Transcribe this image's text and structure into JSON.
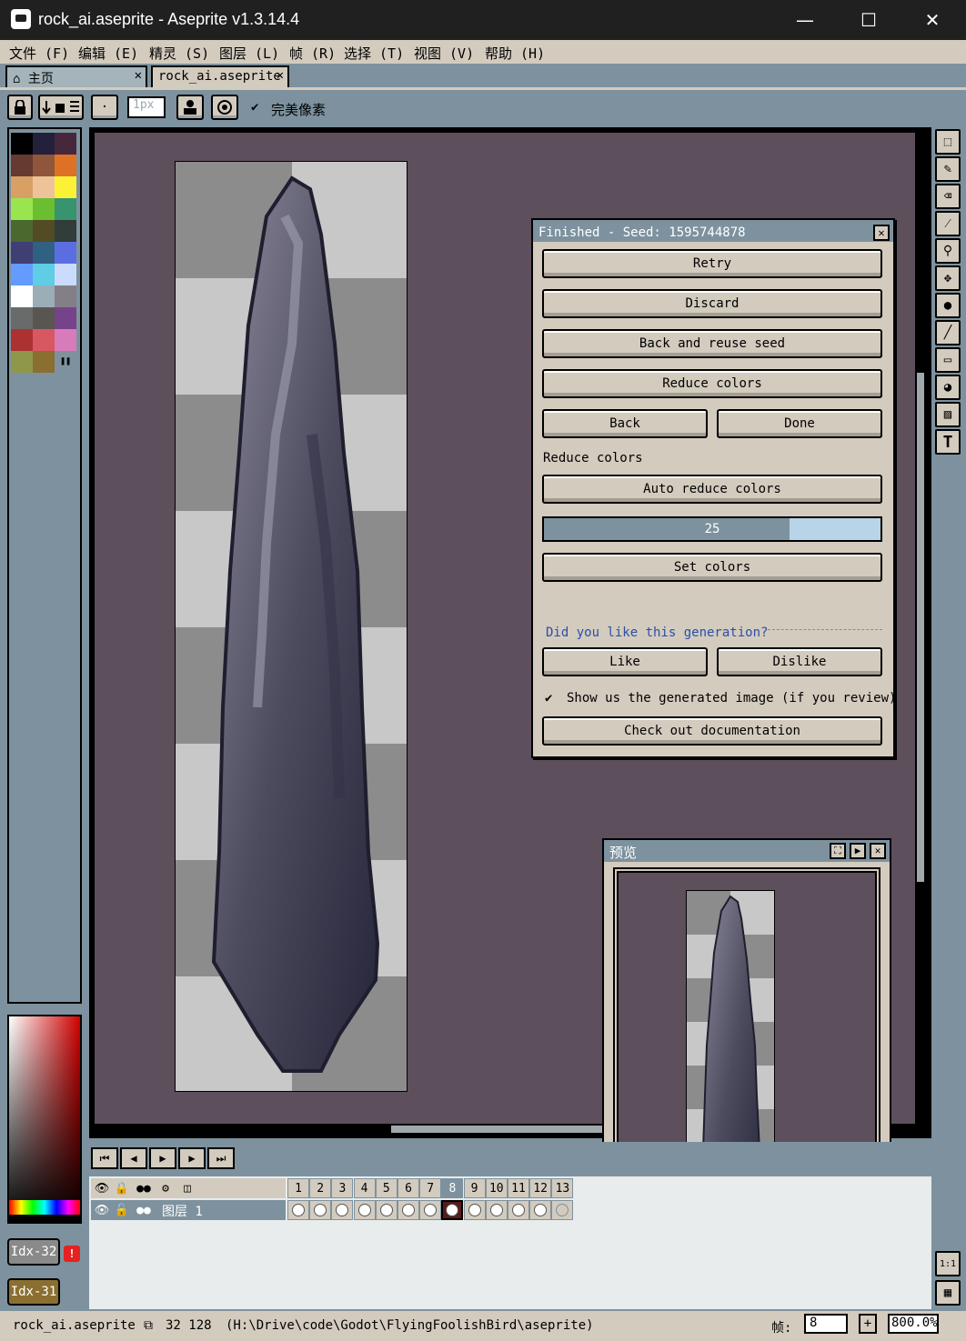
{
  "window": {
    "title": "rock_ai.aseprite - Aseprite v1.3.14.4",
    "minimize": "—",
    "maximize": "☐",
    "close": "✕"
  },
  "menu": [
    "文件 (F)",
    "编辑 (E)",
    "精灵 (S)",
    "图层 (L)",
    "帧 (R)",
    "选择 (T)",
    "视图 (V)",
    "帮助 (H)"
  ],
  "tabs": [
    {
      "label": "主页",
      "icon": "home-icon",
      "close": "✕"
    },
    {
      "label": "rock_ai.aseprite",
      "close": "✕"
    }
  ],
  "toolbar": {
    "brush_size_placeholder": "1px",
    "pixel_perfect_check": "✔",
    "pixel_perfect_label": "完美像素"
  },
  "palette": {
    "colors": [
      "#000000",
      "#22203a",
      "#45283c",
      "#663931",
      "#8f563b",
      "#df7126",
      "#d9a066",
      "#eec39a",
      "#fbf236",
      "#99e550",
      "#6abe30",
      "#37946e",
      "#4b692f",
      "#524b24",
      "#323c39",
      "#3f3f74",
      "#306082",
      "#5b6ee1",
      "#639bff",
      "#5fcde4",
      "#cbdbfc",
      "#ffffff",
      "#9badb7",
      "#847e87",
      "#696a6a",
      "#595652",
      "#76428a",
      "#ac3232",
      "#d95763",
      "#d77bba",
      "#8f974a",
      "#8a6f30"
    ]
  },
  "color_indices": {
    "fg": "Idx-32",
    "bg": "Idx-31",
    "warning": "!"
  },
  "dialog": {
    "title": "Finished - Seed: 1595744878",
    "close": "✕",
    "retry": "Retry",
    "discard": "Discard",
    "back_reuse": "Back and reuse seed",
    "reduce_colors_btn": "Reduce colors",
    "back": "Back",
    "done": "Done",
    "reduce_colors_label": "Reduce colors",
    "auto_reduce": "Auto reduce colors",
    "slider_value": "25",
    "slider_fraction": 0.73,
    "set_colors": "Set colors",
    "like_question": "Did you like this generation?",
    "like": "Like",
    "dislike": "Dislike",
    "show_check": "✔",
    "show_label": "Show us the generated image (if you review)",
    "docs": "Check out documentation"
  },
  "preview": {
    "title": "预览"
  },
  "timeline": {
    "frames": [
      "1",
      "2",
      "3",
      "4",
      "5",
      "6",
      "7",
      "8",
      "9",
      "10",
      "11",
      "12",
      "13"
    ],
    "active_frame": 8,
    "layer_name": "图层 1",
    "cels_filled": 12
  },
  "status": {
    "filename": "rock_ai.aseprite",
    "size": "32 128",
    "path": "(H:\\Drive\\code\\Godot\\FlyingFoolishBird\\aseprite)",
    "frame_label": "帧:",
    "frame_value": "8",
    "frame_add": "+",
    "zoom": "800.0%"
  },
  "colors": {
    "accent": "#7d929e",
    "panel": "#d3cbbe",
    "canvas_bg": "#5e4f5d",
    "active_cel": "#5a1a1a"
  }
}
